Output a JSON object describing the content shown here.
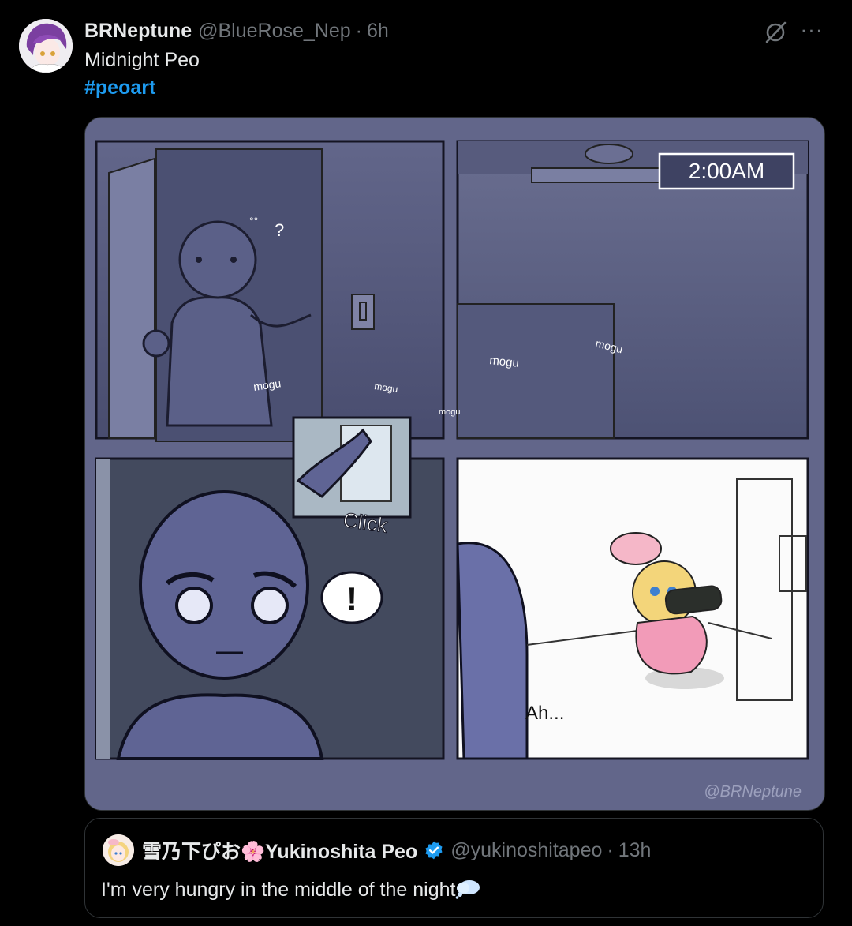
{
  "post": {
    "author_name": "BRNeptune",
    "author_handle": "@BlueRose_Nep",
    "separator": "·",
    "time": "6h",
    "text": "Midnight Peo",
    "hashtag": "#peoart",
    "actions": {
      "grok_icon": "grok-icon",
      "more_icon": "more-icon",
      "more_label": "···"
    }
  },
  "media": {
    "clock_text": "2:00AM",
    "sfx_mogu_1": "mogu",
    "sfx_mogu_2": "mogu",
    "sfx_mogu_3": "mogu",
    "sfx_mogu_4": "mogu",
    "sfx_mogu_5": "mogu",
    "sfx_click": "Click",
    "sfx_question": "?",
    "sfx_exclaim": "!",
    "dialogue_ah": "Ah...",
    "signature": "@BRNeptune"
  },
  "quote": {
    "author_name": "雪乃下ぴお🌸Yukinoshita Peo",
    "author_handle": "@yukinoshitapeo",
    "separator": "·",
    "time": "13h",
    "text": "I'm very hungry in the middle of the night",
    "verified_color": "#1d9bf0"
  },
  "colors": {
    "background": "#000000",
    "text_primary": "#e7e9ea",
    "text_secondary": "#71767b",
    "link": "#1d9bf0"
  }
}
